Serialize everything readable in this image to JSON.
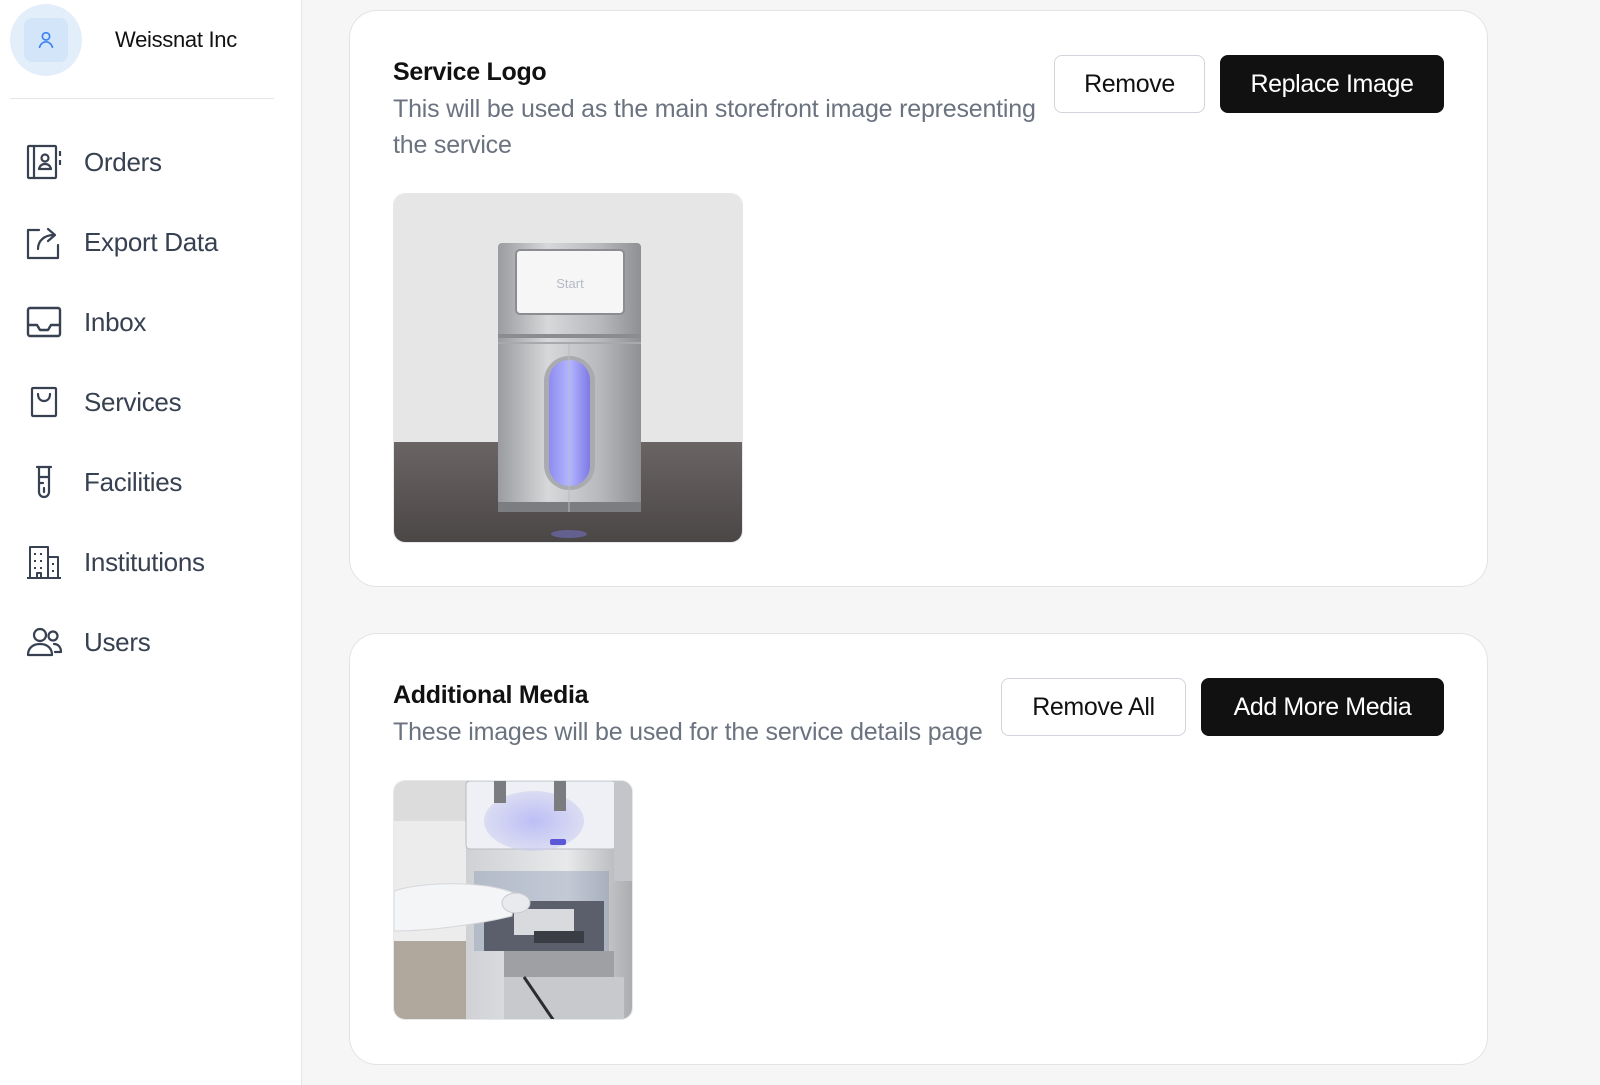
{
  "sidebar": {
    "org_name": "Weissnat Inc",
    "items": [
      {
        "label": "Orders",
        "icon": "orders-icon"
      },
      {
        "label": "Export Data",
        "icon": "export-icon"
      },
      {
        "label": "Inbox",
        "icon": "inbox-icon"
      },
      {
        "label": "Services",
        "icon": "bag-icon"
      },
      {
        "label": "Facilities",
        "icon": "test-tube-icon"
      },
      {
        "label": "Institutions",
        "icon": "building-icon"
      },
      {
        "label": "Users",
        "icon": "users-icon"
      }
    ]
  },
  "service_logo": {
    "title": "Service Logo",
    "description": "This will be used as the main storefront image representing the service",
    "remove_label": "Remove",
    "replace_label": "Replace Image",
    "image_screen_text": "Start"
  },
  "additional_media": {
    "title": "Additional Media",
    "description": "These images will be used for the service details page",
    "remove_all_label": "Remove All",
    "add_more_label": "Add More Media"
  },
  "colors": {
    "primary_button": "#111111",
    "avatar_bg": "#e3eefb",
    "muted_text": "#6b7280"
  }
}
